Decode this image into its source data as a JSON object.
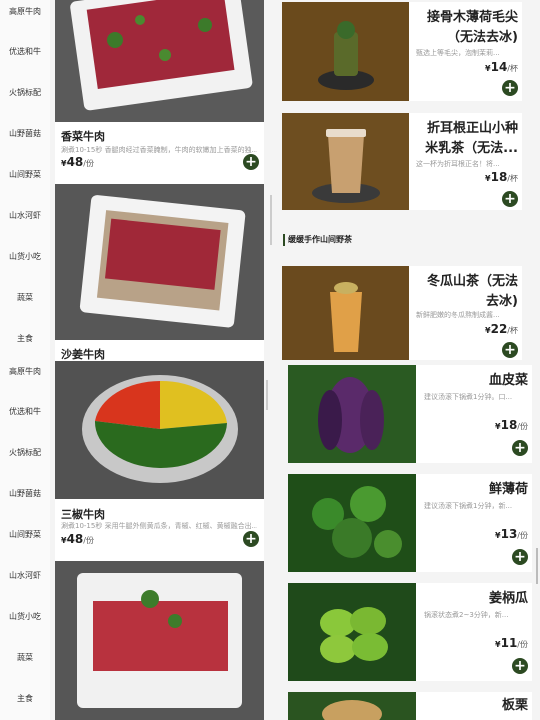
{
  "sidebar_a": [
    "高原牛肉",
    "优选和牛",
    "火锅标配",
    "山野菌菇",
    "山间野菜",
    "山水河虾",
    "山货小吃",
    "蔬菜",
    "主食"
  ],
  "sidebar_b": [
    "高原牛肉",
    "优选和牛",
    "火锅标配",
    "山野菌菇",
    "山间野菜",
    "山水河虾",
    "山货小吃",
    "蔬菜",
    "主食"
  ],
  "left": {
    "items": [
      {
        "title": "香菜牛肉",
        "desc": "香菜牛肉经过香菜腌制，牛肉的软嫩加上香菜的独...",
        "price": "48",
        "currency": "¥",
        "unit": "/份"
      },
      {
        "title": "沙姜牛肉"
      },
      {
        "title": "三椒牛肉",
        "desc": "涮煮10-15秒 采用牛腿外侧黄瓜条，青椒、红椒、黄椒融合出...",
        "price": "48",
        "currency": "¥",
        "unit": "/份"
      }
    ],
    "desc_first": "涮煮10-15秒 香腿肉经过香菜腌制，牛肉的软嫩加上香菜的独..."
  },
  "drinks": [
    {
      "title_l1": "接骨木薄荷毛尖",
      "title_l2": "（无法去冰)",
      "desc": "甄选上等毛尖，泡制茉莉...",
      "price": "14",
      "currency": "¥",
      "unit": "/杯"
    },
    {
      "title_l1": "折耳根正山小种",
      "title_l2": "米乳茶（无法...",
      "desc": "这一杯为折耳根正名！将...",
      "price": "18",
      "currency": "¥",
      "unit": "/杯"
    },
    {
      "title_l1": "冬瓜山茶（无法",
      "title_l2": "去冰)",
      "desc": "新鲜肥嫩的冬瓜熬制成酱...",
      "price": "22",
      "currency": "¥",
      "unit": "/杯"
    }
  ],
  "section_title": "缓缓手作山间野茶",
  "veggies": [
    {
      "title": "血皮菜",
      "desc": "建议汤滚下锅煮1分钟。口...",
      "price": "18",
      "currency": "¥",
      "unit": "/份"
    },
    {
      "title": "鲜薄荷",
      "desc": "建议汤滚下锅煮1分钟，新...",
      "price": "13",
      "currency": "¥",
      "unit": "/份"
    },
    {
      "title": "姜柄瓜",
      "desc": "锅滚状态煮2~3分钟，新...",
      "price": "11",
      "currency": "¥",
      "unit": "/份"
    },
    {
      "title": "板栗"
    }
  ],
  "add_symbol": "+",
  "colors": {
    "accent": "#2c4a22",
    "bg": "#f4f4f4"
  }
}
